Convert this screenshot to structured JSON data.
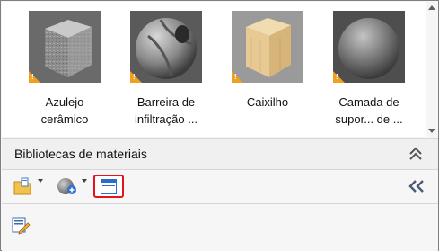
{
  "materials": {
    "items": [
      {
        "name": "Azulejo cerâmico",
        "line1": "Azulejo",
        "line2": "cerâmico",
        "icon": "ceramic-tile-cube-thumbnail"
      },
      {
        "name": "Barreira de infiltração ...",
        "line1": "Barreira de",
        "line2": "infiltração ...",
        "icon": "infiltration-barrier-sphere-thumbnail"
      },
      {
        "name": "Caixilho",
        "line1": "Caixilho",
        "line2": "",
        "icon": "wood-cube-thumbnail"
      },
      {
        "name": "Camada de supor... de ...",
        "line1": "Camada de",
        "line2": "supor... de ...",
        "icon": "support-layer-sphere-thumbnail"
      }
    ]
  },
  "libraries": {
    "title": "Bibliotecas de materiais"
  },
  "colors": {
    "highlight_border": "#e0141a",
    "warning": "#f0a020"
  }
}
